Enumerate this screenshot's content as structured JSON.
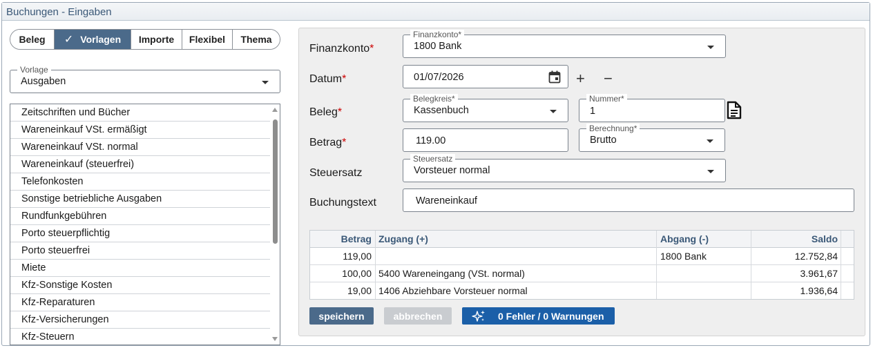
{
  "panel": {
    "title": "Buchungen - Eingaben"
  },
  "tabs": [
    {
      "label": "Beleg",
      "active": false
    },
    {
      "label": "Vorlagen",
      "active": true
    },
    {
      "label": "Importe",
      "active": false
    },
    {
      "label": "Flexibel",
      "active": false
    },
    {
      "label": "Thema",
      "active": false
    }
  ],
  "template_select": {
    "label": "Vorlage",
    "value": "Ausgaben"
  },
  "template_list": [
    "Zeitschriften und Bücher",
    "Wareneinkauf VSt. ermäßigt",
    "Wareneinkauf VSt. normal",
    "Wareneinkauf (steuerfrei)",
    "Telefonkosten",
    "Sonstige betriebliche Ausgaben",
    "Rundfunkgebühren",
    "Porto steuerpflichtig",
    "Porto steuerfrei",
    "Miete",
    "Kfz-Sonstige Kosten",
    "Kfz-Reparaturen",
    "Kfz-Versicherungen",
    "Kfz-Steuern"
  ],
  "form": {
    "finanzkonto": {
      "row_label": "Finanzkonto",
      "field_label": "Finanzkonto*",
      "value": "1800 Bank"
    },
    "datum": {
      "row_label": "Datum",
      "value": "01/07/2026",
      "plus": "+",
      "minus": "−"
    },
    "beleg": {
      "row_label": "Beleg",
      "belegkreis_label": "Belegkreis*",
      "belegkreis_value": "Kassenbuch",
      "nummer_label": "Nummer*",
      "nummer_value": "1"
    },
    "betrag": {
      "row_label": "Betrag",
      "value": "119.00",
      "berechnung_label": "Berechnung*",
      "berechnung_value": "Brutto"
    },
    "steuersatz": {
      "row_label": "Steuersatz",
      "field_label": "Steuersatz",
      "value": "Vorsteuer normal"
    },
    "buchungstext": {
      "row_label": "Buchungstext",
      "value": "Wareneinkauf"
    },
    "required_marker": "*"
  },
  "table": {
    "headers": {
      "betrag": "Betrag",
      "zugang": "Zugang (+)",
      "abgang": "Abgang (-)",
      "saldo": "Saldo"
    },
    "rows": [
      {
        "betrag": "119,00",
        "zugang": "",
        "abgang": "1800 Bank",
        "saldo": "12.752,84"
      },
      {
        "betrag": "100,00",
        "zugang": "5400 Wareneingang (VSt. normal)",
        "abgang": "",
        "saldo": "3.961,67"
      },
      {
        "betrag": "19,00",
        "zugang": "1406 Abziehbare Vorsteuer normal",
        "abgang": "",
        "saldo": "1.936,64"
      }
    ]
  },
  "buttons": {
    "save": "speichern",
    "cancel": "abbrechen",
    "status": "0 Fehler / 0 Warnungen"
  },
  "colors": {
    "accent": "#4b6a8a",
    "save_button": "#4b6a8a",
    "cancel_button_disabled": "#c9ccd0",
    "status_button": "#1b5fa8",
    "required": "#cc0000",
    "header_text": "#3a5877"
  }
}
